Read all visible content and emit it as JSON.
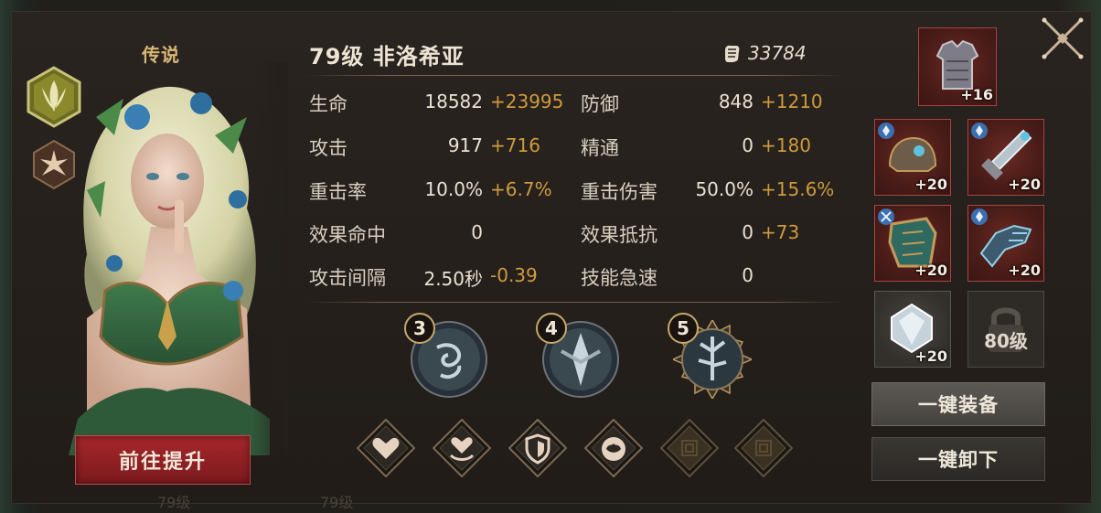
{
  "hero": {
    "rarity": "传说",
    "level_name": "79级  非洛希亚",
    "power": "33784",
    "upgrade_label": "前往提升"
  },
  "stats": [
    {
      "label": "生命",
      "value": "18582",
      "bonus": "+23995"
    },
    {
      "label": "防御",
      "value": "848",
      "bonus": "+1210"
    },
    {
      "label": "攻击",
      "value": "917",
      "bonus": "+716"
    },
    {
      "label": "精通",
      "value": "0",
      "bonus": "+180"
    },
    {
      "label": "重击率",
      "value": "10.0%",
      "bonus": "+6.7%"
    },
    {
      "label": "重击伤害",
      "value": "50.0%",
      "bonus": "+15.6%"
    },
    {
      "label": "效果命中",
      "value": "0",
      "bonus": ""
    },
    {
      "label": "效果抵抗",
      "value": "0",
      "bonus": "+73"
    },
    {
      "label": "攻击间隔",
      "value": "2.50秒",
      "bonus": "-0.39"
    },
    {
      "label": "技能急速",
      "value": "0",
      "bonus": ""
    }
  ],
  "skills": [
    {
      "level": "3",
      "icon": "spiral-skill-icon"
    },
    {
      "level": "4",
      "icon": "blade-skill-icon"
    },
    {
      "level": "5",
      "icon": "tree-skill-icon"
    }
  ],
  "runes": [
    {
      "icon": "heart-icon",
      "filled": true
    },
    {
      "icon": "heart-hand-icon",
      "filled": true
    },
    {
      "icon": "shield-icon",
      "filled": true
    },
    {
      "icon": "strength-icon",
      "filled": true
    },
    {
      "icon": "empty-rune-icon",
      "filled": false
    },
    {
      "icon": "empty-rune-icon",
      "filled": false
    }
  ],
  "equipment": {
    "armor": "+16",
    "helmet": "+20",
    "weapon": "+20",
    "shoulder": "+20",
    "gauntlet": "+20",
    "gem": "+20",
    "locked_label": "80级",
    "equip_all_label": "一键装备",
    "unequip_all_label": "一键卸下"
  },
  "background_text": {
    "left": "79级",
    "mid": "79级"
  },
  "colors": {
    "bonus": "#cf9a3c",
    "accent_gold": "#d8b774",
    "upgrade_red": "#a5272b"
  }
}
